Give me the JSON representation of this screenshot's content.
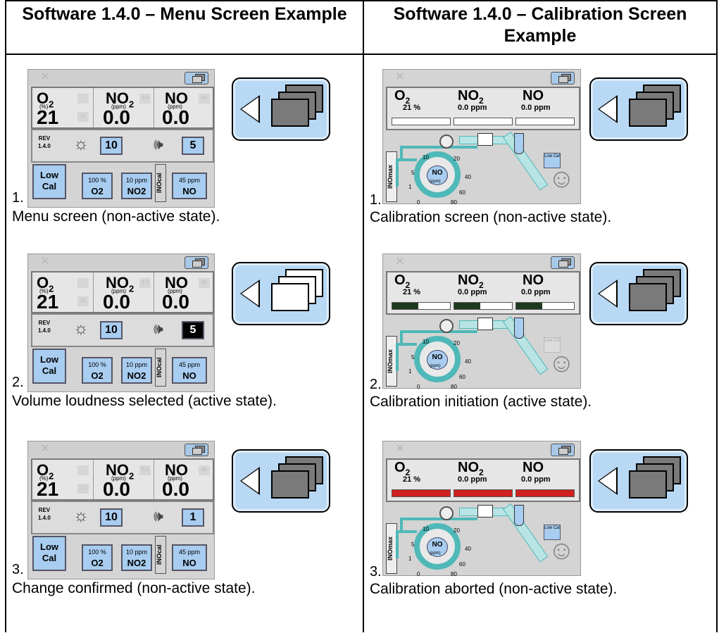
{
  "headers": {
    "left": "Software 1.4.0 – Menu Screen Example",
    "right": "Software 1.4.0 – Calibration Screen Example"
  },
  "device": {
    "o2_label": "O2",
    "no2_label": "NO2",
    "no_label": "NO",
    "pct_unit": "(%)",
    "ppm_unit": "(ppm)",
    "o2_value": "21",
    "no2_value": "0.0",
    "no_value": "0.0",
    "rev_label": "REV",
    "rev_value": "1.4.0",
    "brightness": "10",
    "low_cal": "Low Cal",
    "btn_o2_top": "100 %",
    "btn_o2_bottom": "O2",
    "btn_no2_top": "10 ppm",
    "btn_no2_bottom": "NO2",
    "btn_no_top": "45 ppm",
    "btn_no_bottom": "NO",
    "inocal": "INOcal",
    "cal_o2_value": "21 %",
    "cal_no2_value": "0.0 ppm",
    "cal_no_value": "0.0 ppm",
    "inomax": "INOmax",
    "dial_label": "NO",
    "dial_unit": "(ppm)",
    "low_cal_small": "Low Cal",
    "dial_ticks": [
      "1",
      "5",
      "10",
      "20",
      "40",
      "60",
      "80",
      "0"
    ]
  },
  "menu_examples": [
    {
      "number": "1.",
      "volume": "5",
      "caption": "Menu screen (non-active state)."
    },
    {
      "number": "2.",
      "volume": "5",
      "caption": "Volume loudness selected (active state)."
    },
    {
      "number": "3.",
      "volume": "1",
      "caption": "Change confirmed (non-active state)."
    }
  ],
  "calibration_examples": [
    {
      "number": "1.",
      "caption": "Calibration screen (non-active state).",
      "bar_state": "empty"
    },
    {
      "number": "2.",
      "caption": "Calibration initiation (active state).",
      "bar_state": "progress"
    },
    {
      "number": "3.",
      "caption": "Calibration aborted (non-active state).",
      "bar_state": "aborted"
    }
  ],
  "colors": {
    "bar_progress": "#1e3a1e",
    "bar_aborted": "#d02020",
    "accent": "#a8cdf0",
    "circuit": "#4fb8b8"
  }
}
